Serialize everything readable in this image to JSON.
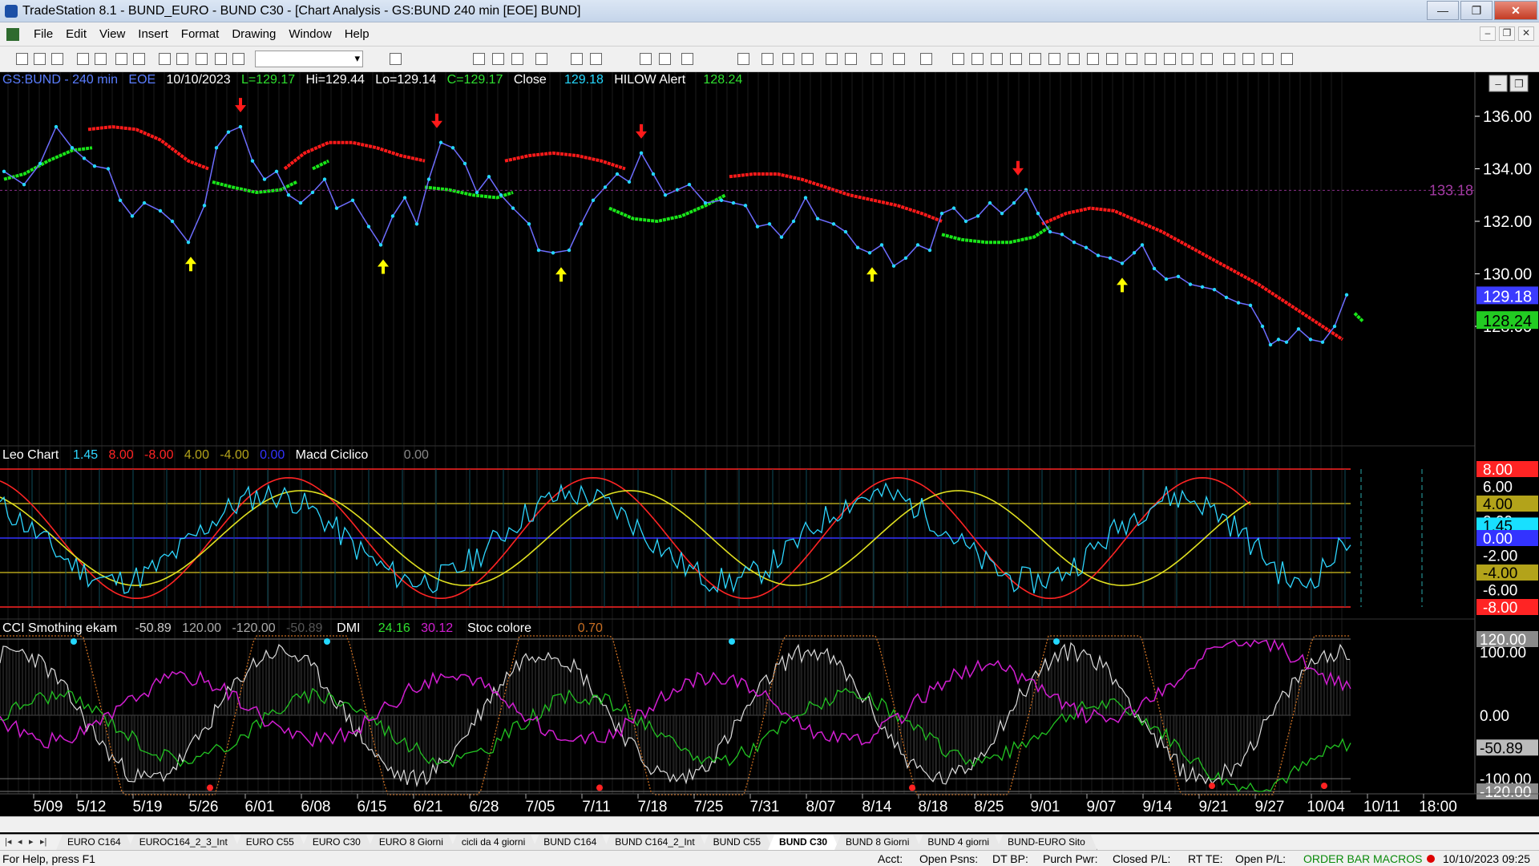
{
  "window": {
    "title": "TradeStation 8.1 - BUND_EURO - BUND  C30 - [Chart Analysis - GS:BUND  240 min  [EOE] BUND]",
    "btn_min": "—",
    "btn_max": "❐",
    "btn_close": "✕"
  },
  "menu": [
    "File",
    "Edit",
    "View",
    "Insert",
    "Format",
    "Drawing",
    "Window",
    "Help"
  ],
  "mdi": {
    "min": "–",
    "restore": "❐",
    "close": "✕"
  },
  "price_header": {
    "symbol": "GS:BUND - 240 min",
    "exchange": "EOE",
    "date": "10/10/2023",
    "last": "L=129.17",
    "high": "Hi=129.44",
    "low": "Lo=129.14",
    "close": "C=129.17",
    "close_label": "Close",
    "close_value": "129.18",
    "alert_label": "HILOW Alert",
    "alert_value": "128.24"
  },
  "macd_header": {
    "name": "Leo Chart",
    "v1": "1.45",
    "v2": "8.00",
    "v3": "-8.00",
    "v4": "4.00",
    "v5": "-4.00",
    "v6": "0.00",
    "name2": "Macd Ciclico",
    "v7": "0.00"
  },
  "cci_header": {
    "name": "CCI Smothing ekam",
    "v1": "-50.89",
    "v2": "120.00",
    "v3": "-120.00",
    "v4": "-50.89",
    "dmi_label": "DMI",
    "dmi_plus": "24.16",
    "dmi_minus": "30.12",
    "stoc_label": "Stoc colore",
    "stoc_value": "0.70"
  },
  "price_axis": [
    "136.00",
    "134.00",
    "132.00",
    "130.00",
    "128.00"
  ],
  "price_tags": {
    "last": "129.18",
    "alert": "128.24",
    "line_label": "133.18"
  },
  "macd_axis": [
    "8.00",
    "6.00",
    "4.00",
    "2.00",
    "1.45",
    "0.00",
    "-2.00",
    "-4.00",
    "-6.00",
    "-8.00"
  ],
  "cci_axis": [
    "120.00",
    "100.00",
    "0.00",
    "-50.89",
    "-100.00",
    "-120.00"
  ],
  "x_labels": [
    "5/09",
    "5/12",
    "5/19",
    "5/26",
    "6/01",
    "6/08",
    "6/15",
    "6/21",
    "6/28",
    "7/05",
    "7/11",
    "7/18",
    "7/25",
    "7/31",
    "8/07",
    "8/14",
    "8/18",
    "8/25",
    "9/01",
    "9/07",
    "9/14",
    "9/21",
    "9/27",
    "10/04",
    "10/11",
    "18:00"
  ],
  "tabs": [
    "EURO C164",
    "EUROC164_2_3_Int",
    "EURO C55",
    "EURO C30",
    "EURO 8 Giorni",
    "cicli da 4 giorni",
    "BUND C164",
    "BUND C164_2_Int",
    "BUND C55",
    "BUND  C30",
    "BUND 8 Giorni",
    "BUND 4 giorni",
    "BUND-EURO Sito"
  ],
  "active_tab": "BUND  C30",
  "status": {
    "help": "For Help, press F1",
    "acct": "Acct:",
    "open_psns": "Open Psns:",
    "dt_bp": "DT BP:",
    "purch_pwr": "Purch Pwr:",
    "closed_pl": "Closed P/L:",
    "rt_te": "RT TE:",
    "open_pl": "Open P/L:",
    "order_bar": "ORDER BAR",
    "macros": "MACROS",
    "datetime": "10/10/2023 09:25"
  },
  "colors": {
    "price_line": "#6d6dff",
    "price_dots": "#24d8ff",
    "hilow_red": "#ff1a1a",
    "hilow_green": "#19e619",
    "header_blue": "#5a7dff",
    "header_green": "#2fe02f",
    "header_white": "#ffffff",
    "macd_cyan": "#2dd6ff",
    "macd_red": "#ff2424",
    "macd_yellow": "#e0e020",
    "macd_blue": "#3333ff",
    "cci_white": "#dcdcdc",
    "dmi_green": "#22c422",
    "dmi_magenta": "#d21ed2",
    "stoc_brown": "#c86e22",
    "up_arrow": "#ffff00",
    "down_arrow": "#ff1a1a"
  }
}
